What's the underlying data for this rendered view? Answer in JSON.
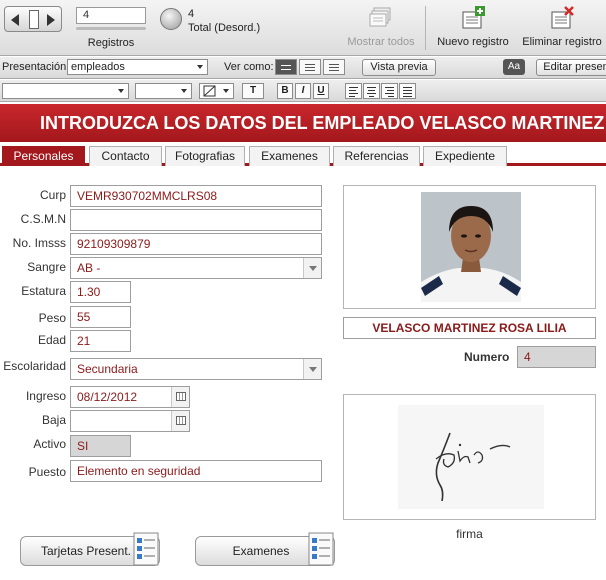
{
  "statusbar": {
    "record_number": "4",
    "records_label": "Registros",
    "total_count": "4",
    "total_state": "Total (Desord.)",
    "show_all_label": "Mostrar todos",
    "new_record_label": "Nuevo registro",
    "delete_record_label": "Eliminar registro"
  },
  "layoutbar": {
    "layout_label": "Presentación:",
    "layout_value": "empleados",
    "view_as_label": "Ver como:",
    "preview_label": "Vista previa",
    "aa_label": "Aa",
    "edit_layout_label": "Editar presen"
  },
  "formatbar": {
    "text_label": "T",
    "bold_label": "B",
    "italic_label": "I",
    "underline_label": "U"
  },
  "title": "INTRODUZCA LOS DATOS DEL EMPLEADO VELASCO MARTINEZ",
  "tabs": [
    "Personales",
    "Contacto",
    "Fotografias",
    "Examenes",
    "Referencias",
    "Expediente"
  ],
  "form": {
    "curp": {
      "label": "Curp",
      "value": "VEMR930702MMCLRS08"
    },
    "csmn": {
      "label": "C.S.M.N",
      "value": ""
    },
    "imss": {
      "label": "No. Imsss",
      "value": "92109309879"
    },
    "sangre": {
      "label": "Sangre",
      "value": "AB -"
    },
    "estatura": {
      "label": "Estatura",
      "value": "1.30"
    },
    "peso": {
      "label": "Peso",
      "value": "55"
    },
    "edad": {
      "label": "Edad",
      "value": "21"
    },
    "escolaridad": {
      "label": "Escolaridad",
      "value": "Secundaria"
    },
    "ingreso": {
      "label": "Ingreso",
      "value": "08/12/2012"
    },
    "baja": {
      "label": "Baja",
      "value": ""
    },
    "activo": {
      "label": "Activo",
      "value": "SI"
    },
    "puesto": {
      "label": "Puesto",
      "value": "Elemento en seguridad"
    }
  },
  "employee": {
    "full_name": "VELASCO MARTINEZ ROSA LILIA",
    "numero_label": "Numero",
    "numero_value": "4",
    "signature_label": "firma"
  },
  "buttons": {
    "tarjetas": "Tarjetas Present.",
    "examenes": "Examenes"
  },
  "colors": {
    "accent": "#a3181c",
    "value_text": "#8b1a1a"
  }
}
